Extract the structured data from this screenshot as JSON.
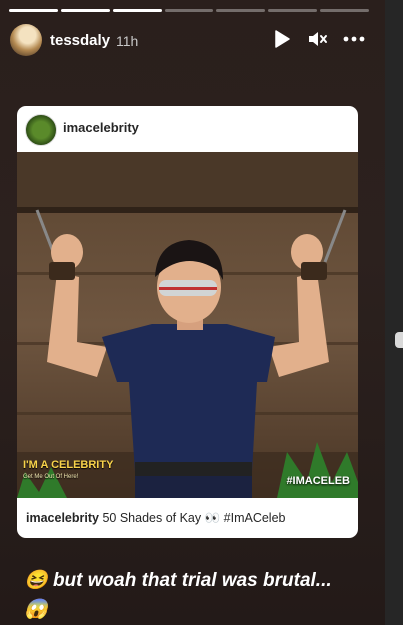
{
  "story": {
    "segments_total": 7,
    "segments_done": 3,
    "username": "tessdaly",
    "time": "11h"
  },
  "icons": {
    "play": "play-icon",
    "mute": "mute-icon",
    "more": "more-icon"
  },
  "post": {
    "account": "imacelebrity",
    "caption_user": "imacelebrity",
    "caption_text": "50 Shades of Kay 👀 #ImACeleb",
    "badge_title": "I'M A CELEBRITY",
    "badge_subtitle": "Get Me Out Of Here!",
    "hashtag_overlay": "#IMACELEB"
  },
  "caption": {
    "emoji_start": "😆",
    "text_line": "but woah that trial was brutal...",
    "emoji_end": "😱"
  },
  "colors": {
    "background": "#2a1f1c",
    "shirt": "#1e2a55"
  }
}
